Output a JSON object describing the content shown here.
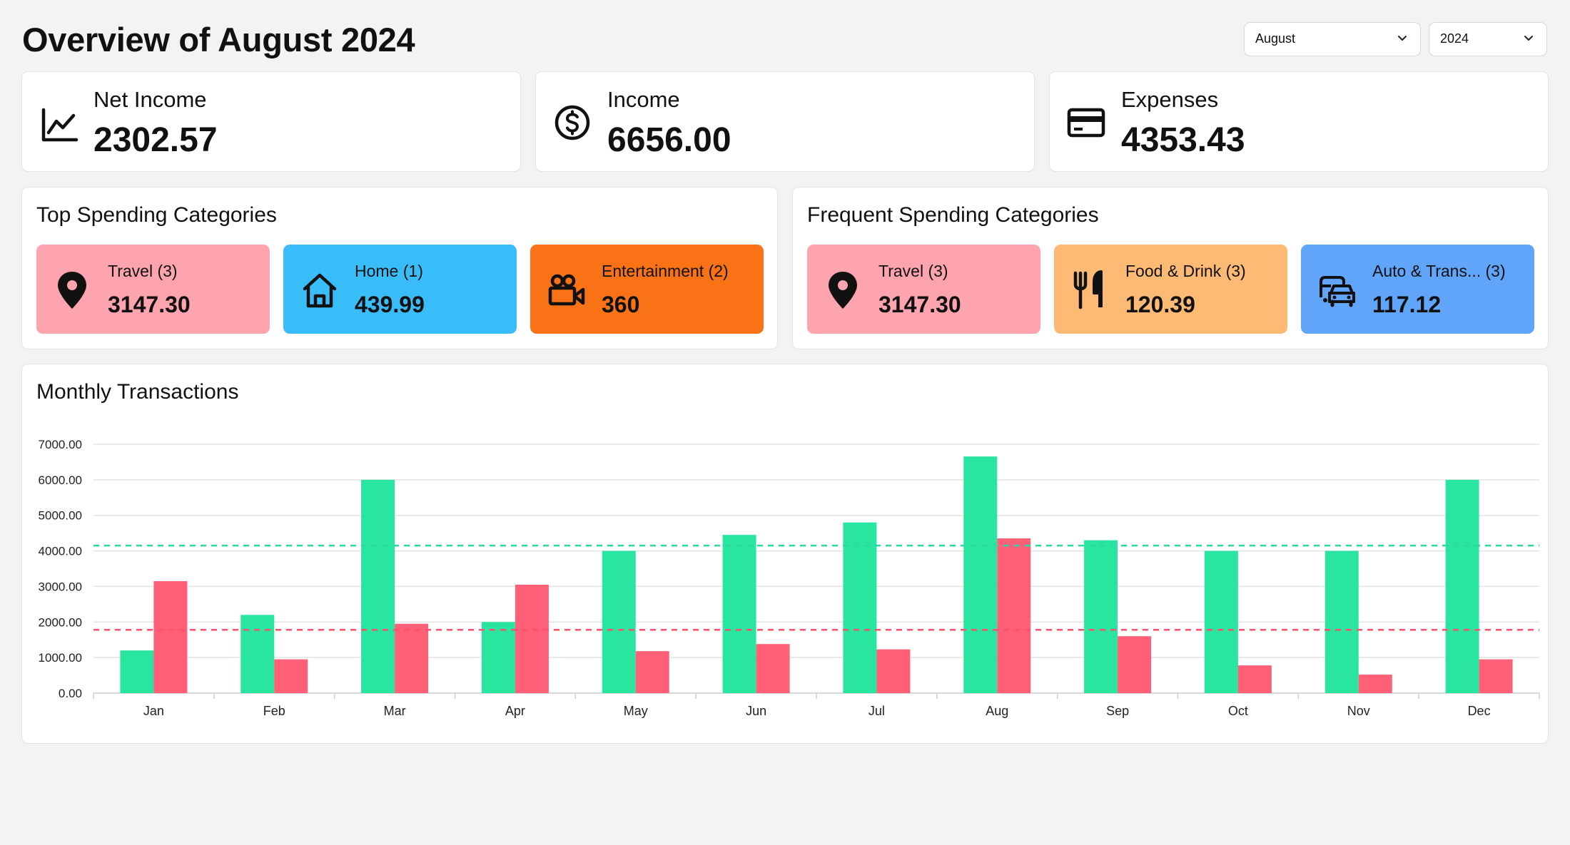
{
  "header": {
    "title": "Overview of August 2024",
    "month_select": "August",
    "year_select": "2024"
  },
  "stats": [
    {
      "label": "Net Income",
      "value": "2302.57",
      "icon": "chart-line-icon"
    },
    {
      "label": "Income",
      "value": "6656.00",
      "icon": "dollar-circle-icon"
    },
    {
      "label": "Expenses",
      "value": "4353.43",
      "icon": "credit-card-icon"
    }
  ],
  "top_spending": {
    "title": "Top Spending Categories",
    "items": [
      {
        "label": "Travel (3)",
        "value": "3147.30",
        "icon": "map-pin-icon",
        "color": "#fda4af"
      },
      {
        "label": "Home (1)",
        "value": "439.99",
        "icon": "home-icon",
        "color": "#38bdf8"
      },
      {
        "label": "Entertainment (2)",
        "value": "360",
        "icon": "video-camera-icon",
        "color": "#f97316"
      }
    ]
  },
  "frequent_spending": {
    "title": "Frequent Spending Categories",
    "items": [
      {
        "label": "Travel (3)",
        "value": "3147.30",
        "icon": "map-pin-icon",
        "color": "#fda4af"
      },
      {
        "label": "Food & Drink (3)",
        "value": "120.39",
        "icon": "utensils-icon",
        "color": "#fdba74"
      },
      {
        "label": "Auto & Trans... (3)",
        "value": "117.12",
        "icon": "car-icon",
        "color": "#60a5fa"
      }
    ]
  },
  "chart_title": "Monthly Transactions",
  "colors": {
    "income": "#2ae5a0",
    "expense": "#ff6078",
    "income_avg": "#2ad8a0",
    "expense_avg": "#ff4f6d"
  },
  "chart_data": {
    "type": "bar",
    "title": "Monthly Transactions",
    "categories": [
      "Jan",
      "Feb",
      "Mar",
      "Apr",
      "May",
      "Jun",
      "Jul",
      "Aug",
      "Sep",
      "Oct",
      "Nov",
      "Dec"
    ],
    "series": [
      {
        "values": [
          1200,
          2200,
          6000,
          2000,
          4000,
          4450,
          4800,
          6656,
          4300,
          4000,
          4000,
          6000
        ]
      },
      {
        "values": [
          3150,
          950,
          1950,
          3050,
          1180,
          1380,
          1230,
          4353.43,
          1600,
          780,
          520,
          950
        ]
      }
    ],
    "reference_lines": [
      4150,
      1780
    ],
    "ylim": [
      0,
      7000
    ],
    "yticks": [
      "0.00",
      "1000.00",
      "2000.00",
      "3000.00",
      "4000.00",
      "5000.00",
      "6000.00",
      "7000.00"
    ],
    "grid": true
  }
}
